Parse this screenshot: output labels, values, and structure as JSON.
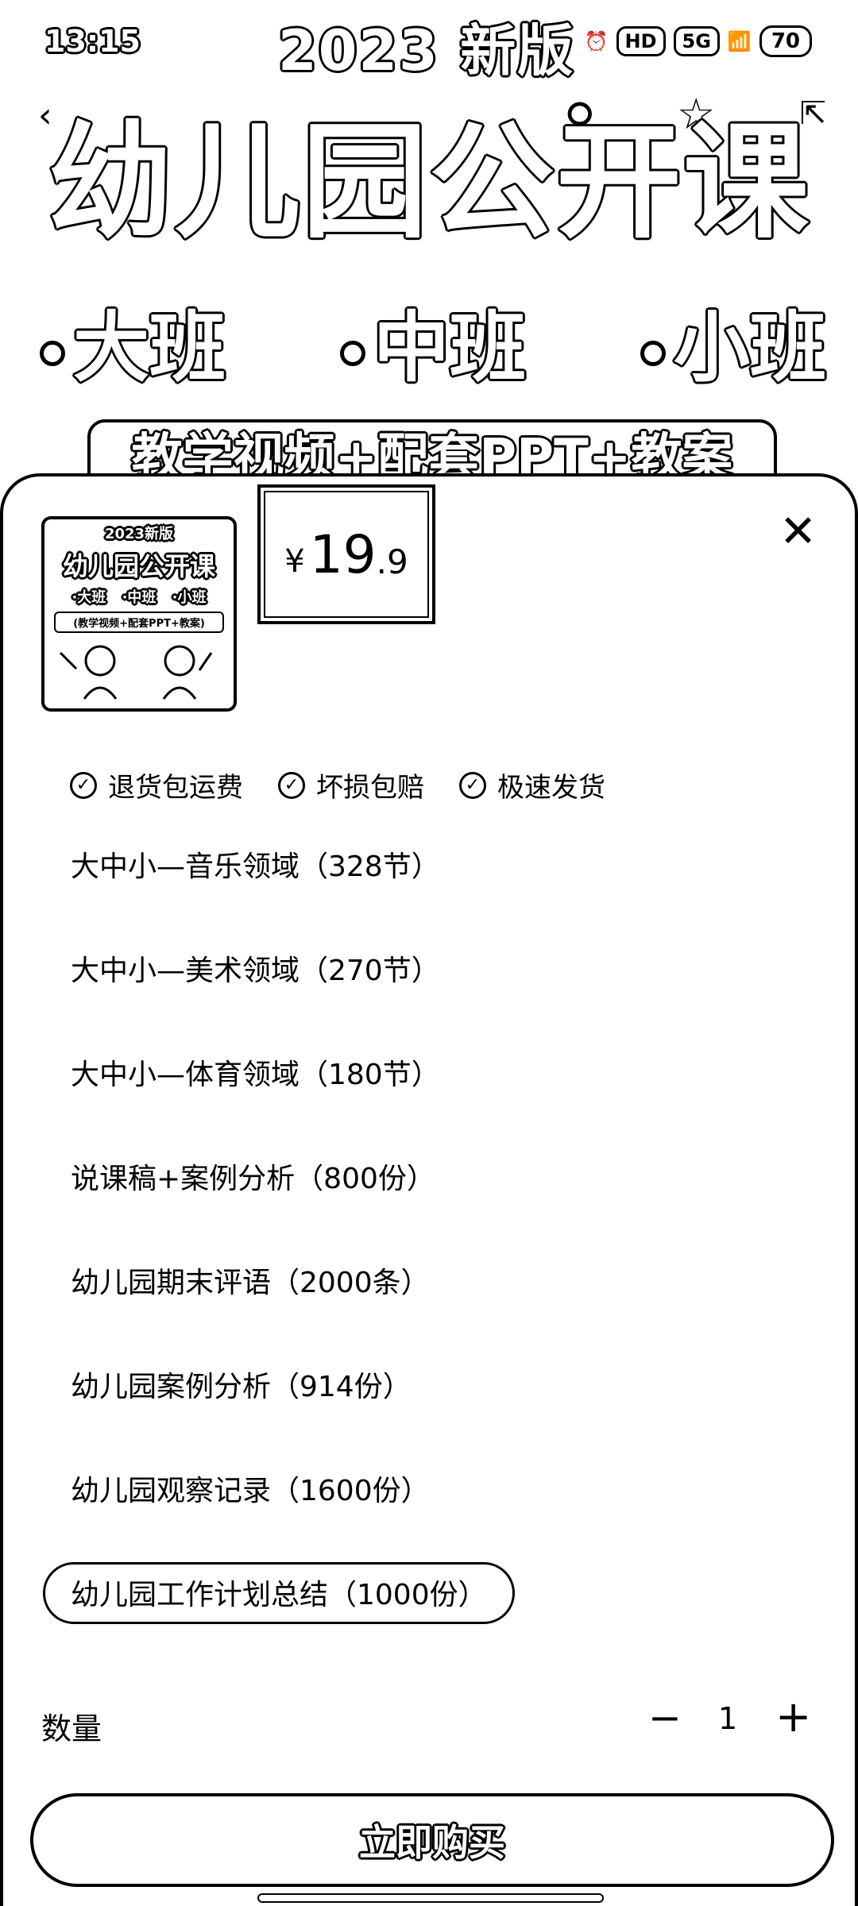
{
  "status_bar": {
    "time": "13:15",
    "network": "5G",
    "hd": "HD",
    "battery": "70"
  },
  "banner": {
    "year_label": "2023 新版",
    "title": "幼儿园公开课",
    "classes": [
      "大班",
      "中班",
      "小班"
    ],
    "subtitle": "教学视频+配套PPT+教案"
  },
  "thumbnail": {
    "year": "2023新版",
    "title": "幼儿园公开课",
    "classes": "·大班 ·中班 ·小班",
    "subtitle": "(教学视频+配套PPT+教案)"
  },
  "price": {
    "currency": "¥",
    "integer": "19",
    "decimal": ".9"
  },
  "guarantees": [
    "退货包运费",
    "坏损包赔",
    "极速发货"
  ],
  "options": [
    {
      "label": "大中小—音乐领域（328节）",
      "selected": false
    },
    {
      "label": "大中小—美术领域（270节）",
      "selected": false
    },
    {
      "label": "大中小—体育领域（180节）",
      "selected": false
    },
    {
      "label": "说课稿+案例分析（800份）",
      "selected": false
    },
    {
      "label": "幼儿园期末评语（2000条）",
      "selected": false
    },
    {
      "label": "幼儿园案例分析（914份）",
      "selected": false
    },
    {
      "label": "幼儿园观察记录（1600份）",
      "selected": false
    },
    {
      "label": "幼儿园工作计划总结（1000份）",
      "selected": true
    }
  ],
  "quantity": {
    "label": "数量",
    "minus": "−",
    "value": "1",
    "plus": "+"
  },
  "buy_button": {
    "label": "立即购买"
  },
  "icons": {
    "close": "close-icon",
    "check": "check-circle-icon",
    "back": "chevron-left-icon",
    "share": "share-icon"
  }
}
